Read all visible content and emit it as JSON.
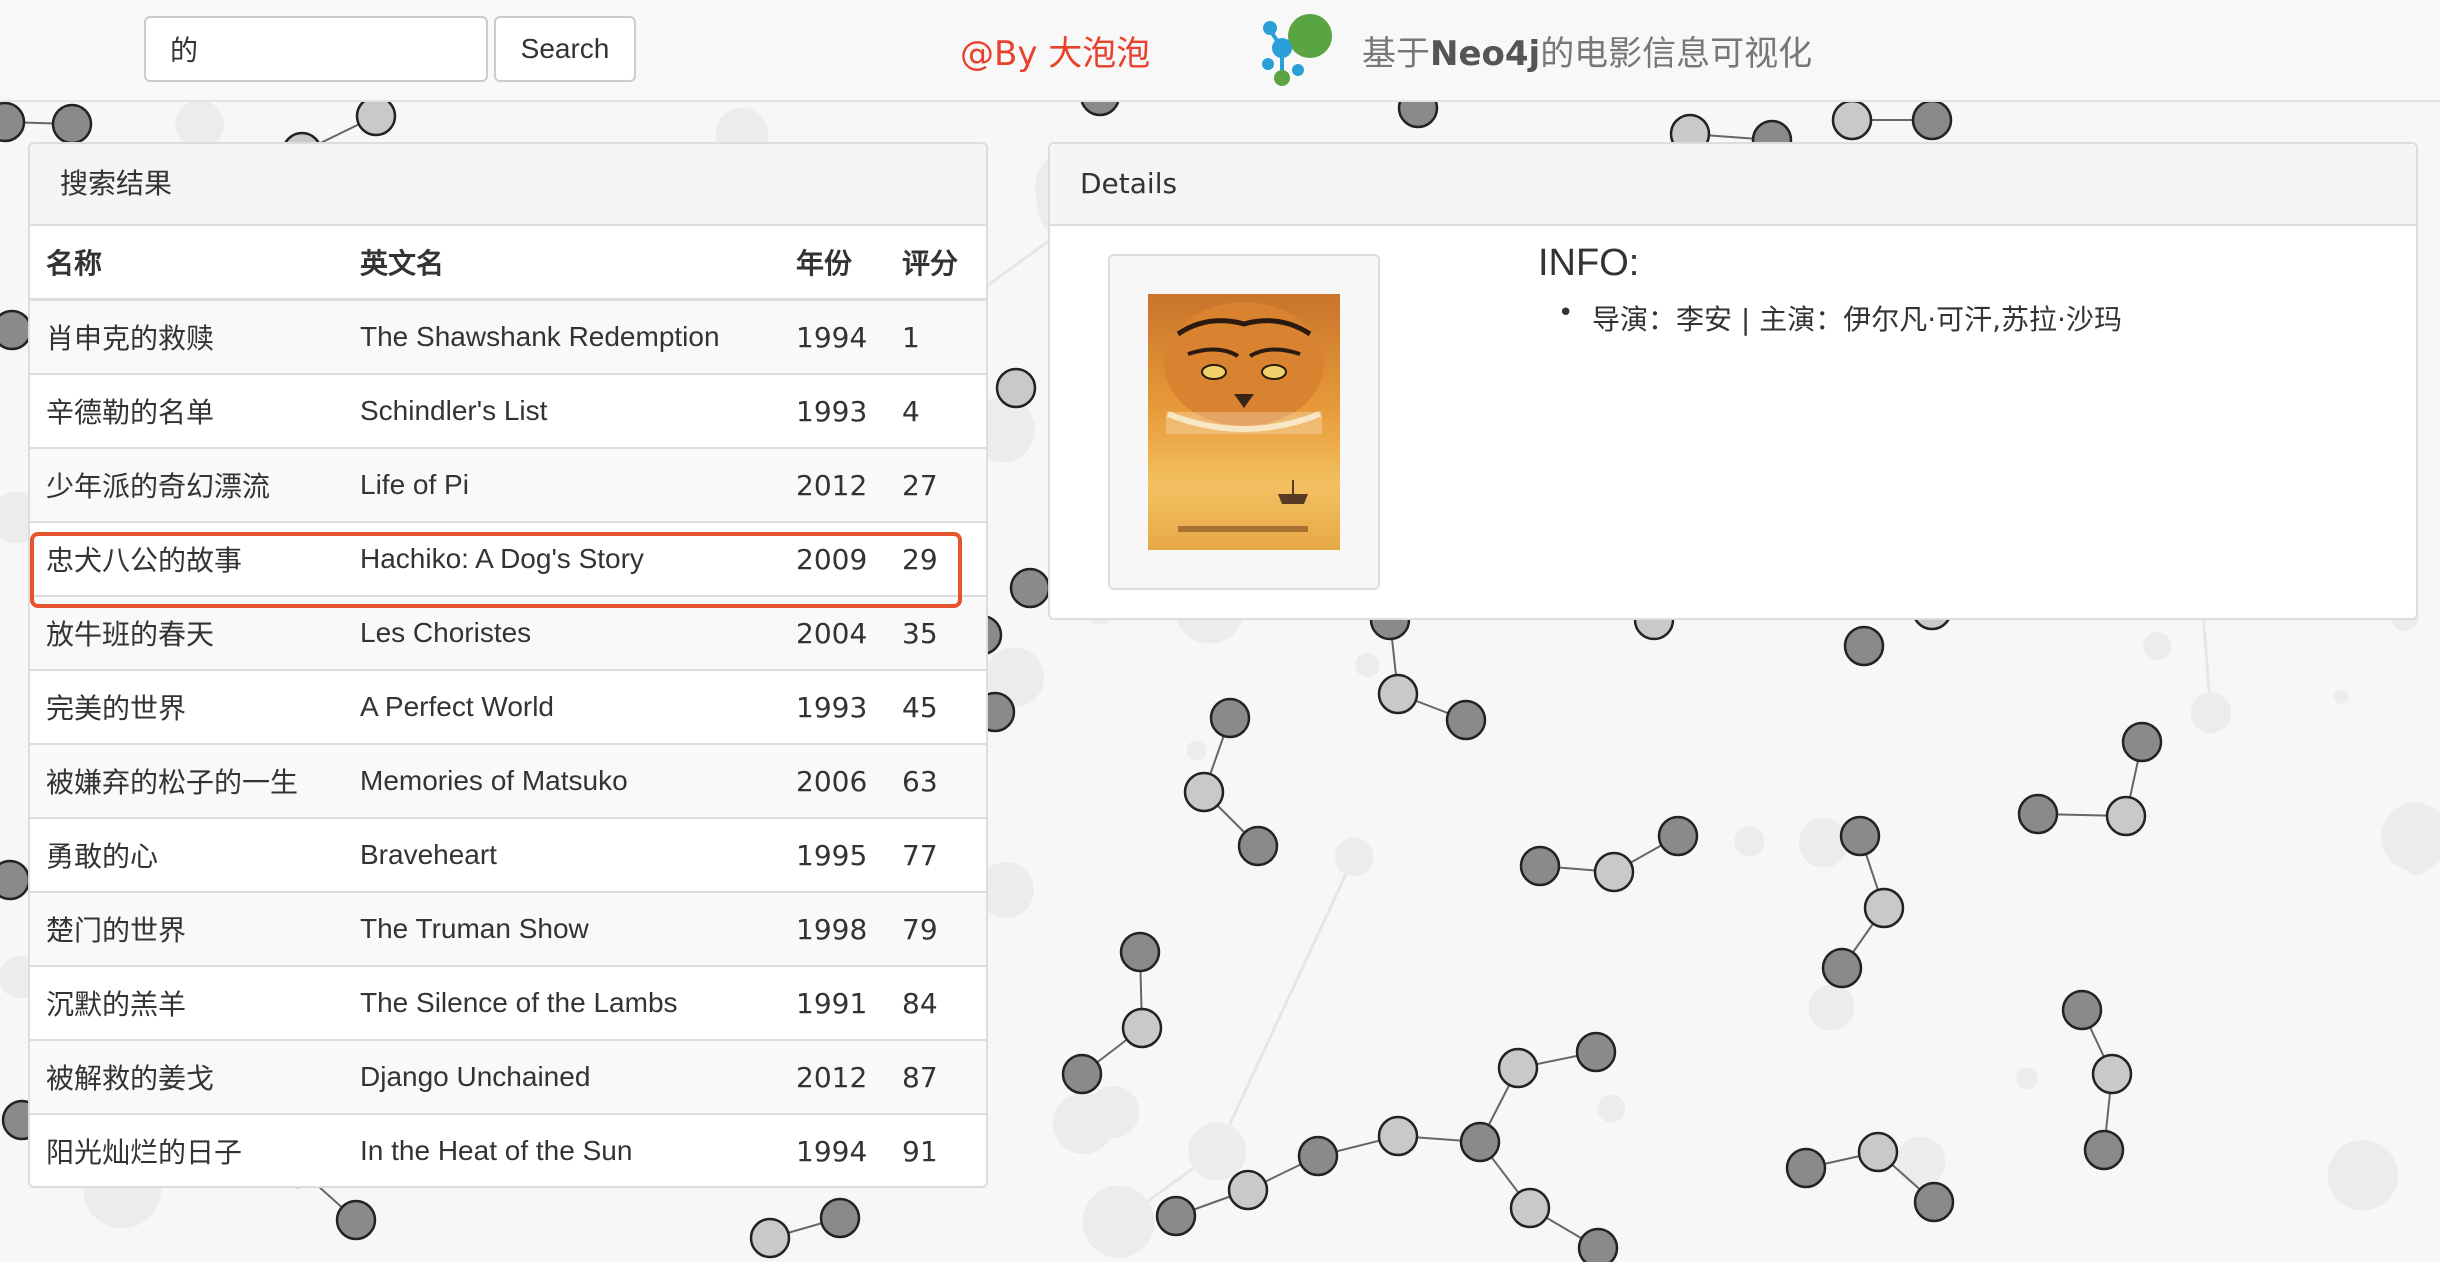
{
  "search": {
    "value": "的",
    "button_label": "Search"
  },
  "header": {
    "by_label": "@By 大泡泡",
    "title_prefix": "基于",
    "title_brand": "Neo4j",
    "title_suffix": "的电影信息可视化"
  },
  "results": {
    "heading": "搜索结果",
    "columns": [
      "名称",
      "英文名",
      "年份",
      "评分"
    ],
    "selected_index": 2,
    "rows": [
      [
        "肖申克的救赎",
        "The Shawshank Redemption",
        "1994",
        "1"
      ],
      [
        "辛德勒的名单",
        "Schindler's List",
        "1993",
        "4"
      ],
      [
        "少年派的奇幻漂流",
        "Life of Pi",
        "2012",
        "27"
      ],
      [
        "忠犬八公的故事",
        "Hachiko: A Dog's Story",
        "2009",
        "29"
      ],
      [
        "放牛班的春天",
        "Les Choristes",
        "2004",
        "35"
      ],
      [
        "完美的世界",
        "A Perfect World",
        "1993",
        "45"
      ],
      [
        "被嫌弃的松子的一生",
        "Memories of Matsuko",
        "2006",
        "63"
      ],
      [
        "勇敢的心",
        "Braveheart",
        "1995",
        "77"
      ],
      [
        "楚门的世界",
        "The Truman Show",
        "1998",
        "79"
      ],
      [
        "沉默的羔羊",
        "The Silence of the Lambs",
        "1991",
        "84"
      ],
      [
        "被解救的姜戈",
        "Django Unchained",
        "2012",
        "87"
      ],
      [
        "阳光灿烂的日子",
        "In the Heat of the Sun",
        "1994",
        "91"
      ]
    ]
  },
  "details": {
    "heading": "Details",
    "info_title": "INFO:",
    "info_line": "导演：李安 | 主演：伊尔凡·可汗,苏拉·沙玛",
    "poster_title": "少年派的奇幻漂流"
  },
  "colors": {
    "accent": "#e8412c",
    "highlight_border": "#e5532f",
    "node_dark": "#8a8a8a",
    "node_light": "#c9c9c9"
  }
}
